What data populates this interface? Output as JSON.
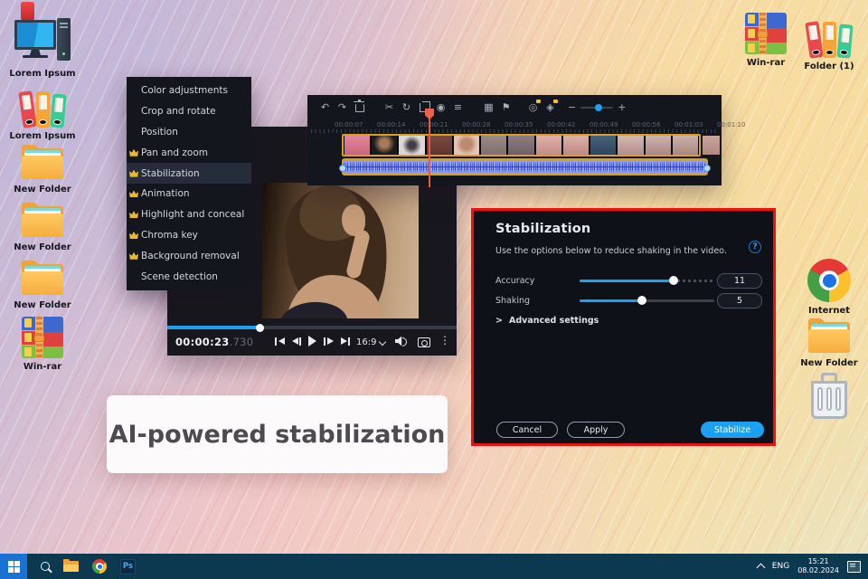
{
  "banner": {
    "text": "AI-powered stabilization"
  },
  "desktop": {
    "icons_left": [
      {
        "label": "Lorem Ipsum"
      },
      {
        "label": "Lorem Ipsum"
      },
      {
        "label": "New Folder"
      },
      {
        "label": "New Folder"
      },
      {
        "label": "New Folder"
      },
      {
        "label": "Win-rar"
      }
    ],
    "icons_top_right": [
      {
        "label": "Win-rar"
      },
      {
        "label": "Folder (1)"
      }
    ],
    "icons_right": [
      {
        "label": "Internet"
      },
      {
        "label": "New Folder"
      }
    ]
  },
  "context_menu": {
    "items": [
      {
        "label": "Color adjustments"
      },
      {
        "label": "Crop and rotate"
      },
      {
        "label": "Position"
      },
      {
        "label": "Pan and zoom"
      },
      {
        "label": "Stabilization"
      },
      {
        "label": "Animation"
      },
      {
        "label": "Highlight and conceal"
      },
      {
        "label": "Chroma key"
      },
      {
        "label": "Background removal"
      },
      {
        "label": "Scene detection"
      }
    ]
  },
  "preview": {
    "time": "00:00:23",
    "time_ms": ".730",
    "aspect": "16:9"
  },
  "timeline": {
    "ruler": [
      "00:00:07",
      "00:00:14",
      "00:00:21",
      "00:00:28",
      "00:00:35",
      "00:00:42",
      "00:00:49",
      "00:00:56",
      "00:01:03",
      "00:01:10"
    ]
  },
  "icons": {
    "undo": "↶",
    "redo": "↷",
    "scissors": "✂",
    "rotate": "↻",
    "speed": "◉",
    "settings": "≡",
    "pip": "▦",
    "marker": "⚑",
    "stabilize_tool": "◎",
    "tracking_tool": "◈",
    "zoom_out": "−",
    "zoom_in": "+",
    "kebab": "⋮"
  },
  "dialog": {
    "title": "Stabilization",
    "description": "Use the options below to reduce shaking in the video.",
    "help_glyph": "?",
    "sliders": [
      {
        "label": "Accuracy",
        "value": "11"
      },
      {
        "label": "Shaking",
        "value": "5"
      }
    ],
    "advanced_arrow": ">",
    "advanced_label": "Advanced settings",
    "cancel_label": "Cancel",
    "apply_label": "Apply",
    "stabilize_label": "Stabilize"
  },
  "taskbar": {
    "ps_label": "Ps",
    "lang": "ENG",
    "time": "15:21",
    "date": "08.02.2024"
  },
  "colors": {
    "accent_blue": "#1da0f2",
    "selection_yellow": "#d8a21c",
    "alert_red": "#ee1111",
    "premium_gold": "#ecb82f"
  }
}
